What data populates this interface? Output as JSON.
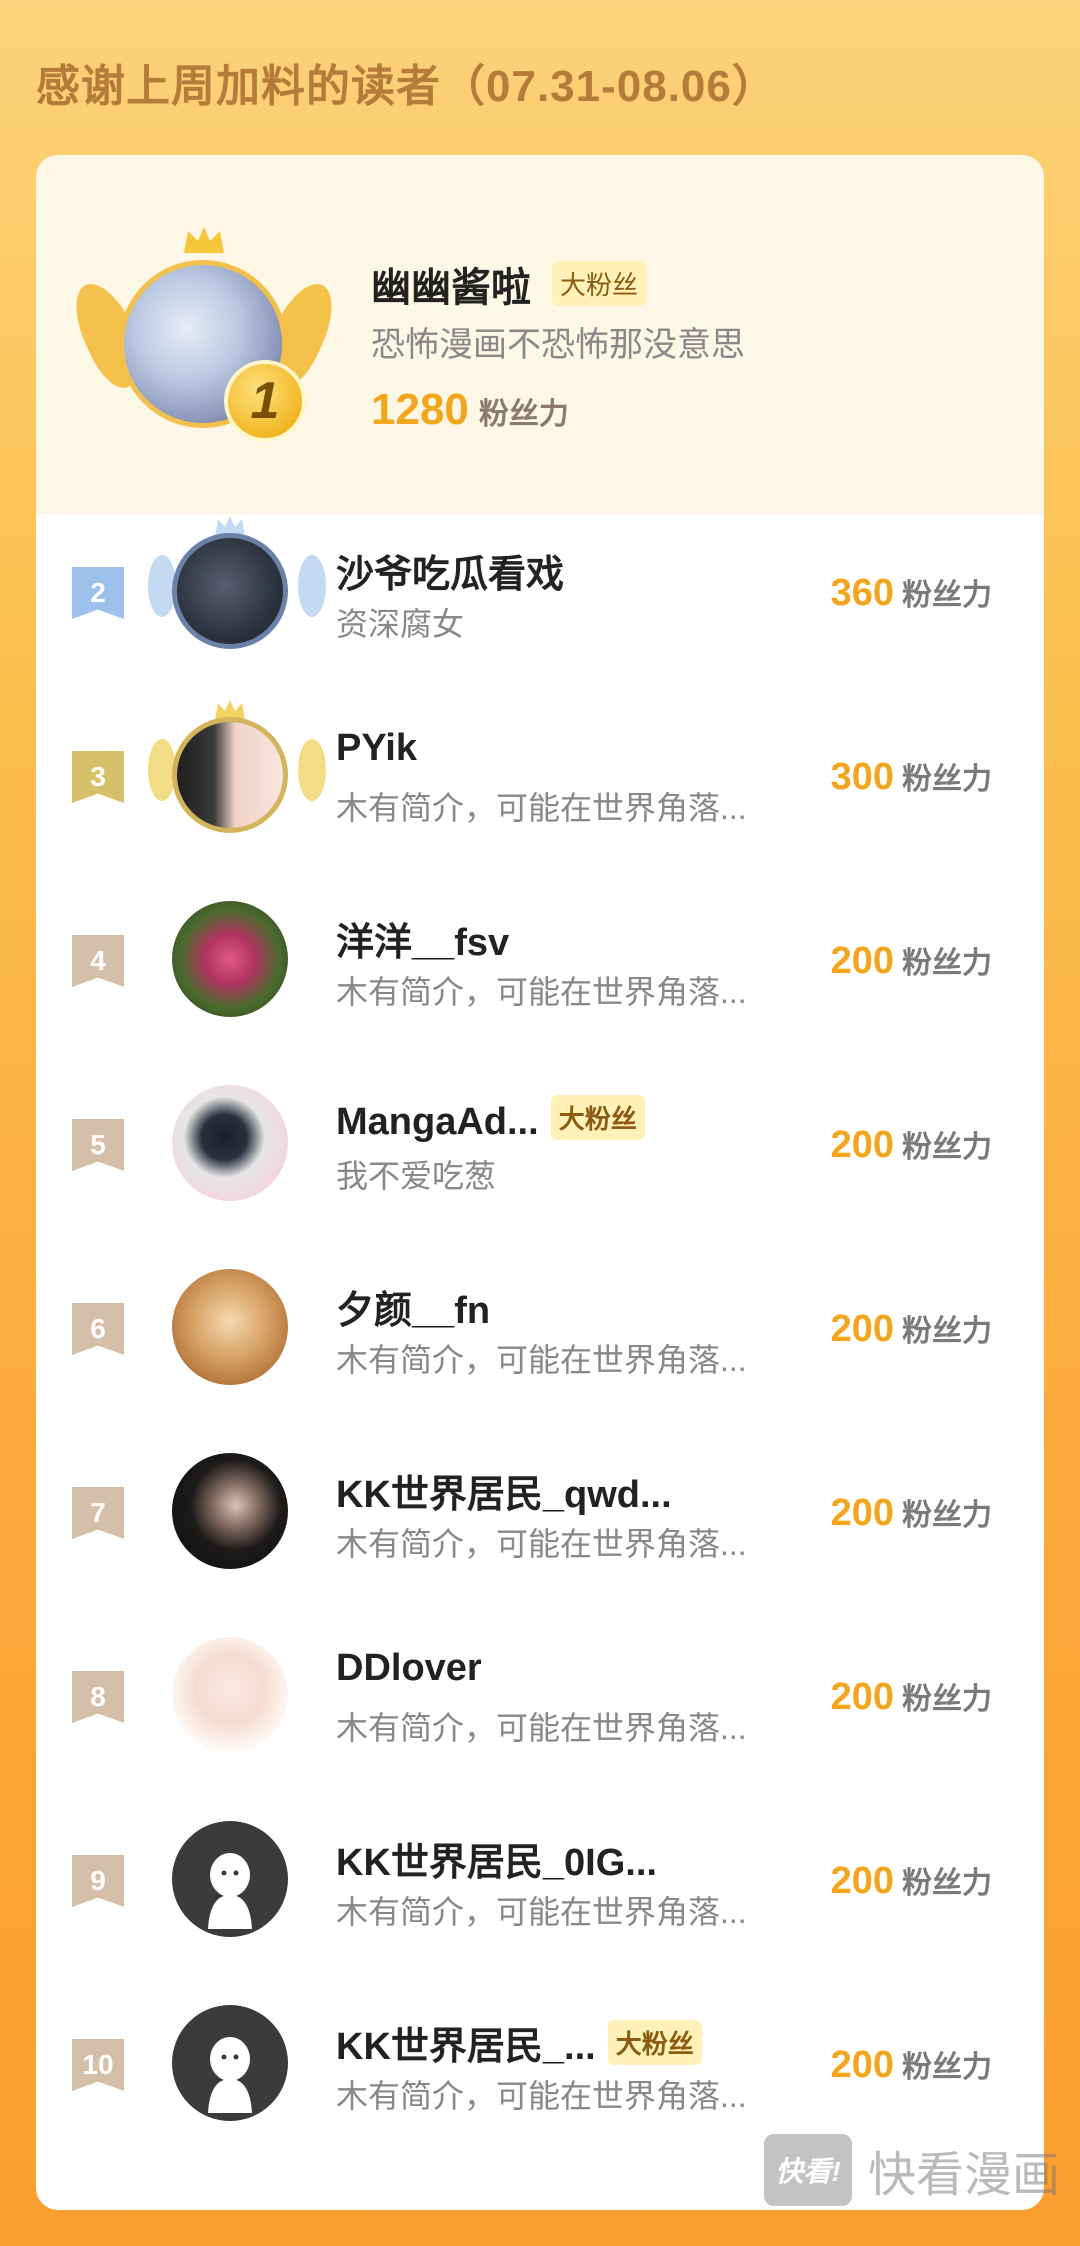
{
  "header": {
    "title": "感谢上周加料的读者（07.31-08.06）"
  },
  "first": {
    "rank": "1",
    "name": "幽幽酱啦",
    "tag": "大粉丝",
    "desc": "恐怖漫画不恐怖那没意思",
    "score": "1280",
    "unit": "粉丝力"
  },
  "ranking": [
    {
      "rank": "2",
      "name": "沙爷吃瓜看戏",
      "tag": "",
      "desc": "资深腐女",
      "score": "360",
      "unit": "粉丝力"
    },
    {
      "rank": "3",
      "name": "PYik",
      "tag": "",
      "desc": "木有简介，可能在世界角落...",
      "score": "300",
      "unit": "粉丝力"
    },
    {
      "rank": "4",
      "name": "洋洋__fsv",
      "tag": "",
      "desc": "木有简介，可能在世界角落...",
      "score": "200",
      "unit": "粉丝力"
    },
    {
      "rank": "5",
      "name": "MangaAd...",
      "tag": "大粉丝",
      "desc": "我不爱吃葱",
      "score": "200",
      "unit": "粉丝力"
    },
    {
      "rank": "6",
      "name": "夕颜__fn",
      "tag": "",
      "desc": "木有简介，可能在世界角落...",
      "score": "200",
      "unit": "粉丝力"
    },
    {
      "rank": "7",
      "name": "KK世界居民_qwd...",
      "tag": "",
      "desc": "木有简介，可能在世界角落...",
      "score": "200",
      "unit": "粉丝力"
    },
    {
      "rank": "8",
      "name": "DDlover",
      "tag": "",
      "desc": "木有简介，可能在世界角落...",
      "score": "200",
      "unit": "粉丝力"
    },
    {
      "rank": "9",
      "name": "KK世界居民_0IG...",
      "tag": "",
      "desc": "木有简介，可能在世界角落...",
      "score": "200",
      "unit": "粉丝力"
    },
    {
      "rank": "10",
      "name": "KK世界居民_...",
      "tag": "大粉丝",
      "desc": "木有简介，可能在世界角落...",
      "score": "200",
      "unit": "粉丝力"
    }
  ],
  "watermark": {
    "logo": "快看!",
    "text": "快看漫画"
  },
  "colors": {
    "accent": "#f3a51c",
    "tag_bg": "#fff1b8",
    "rank2": "#9cc1ea",
    "rank3": "#d8c06a",
    "rank_other": "#d6bfaa"
  }
}
